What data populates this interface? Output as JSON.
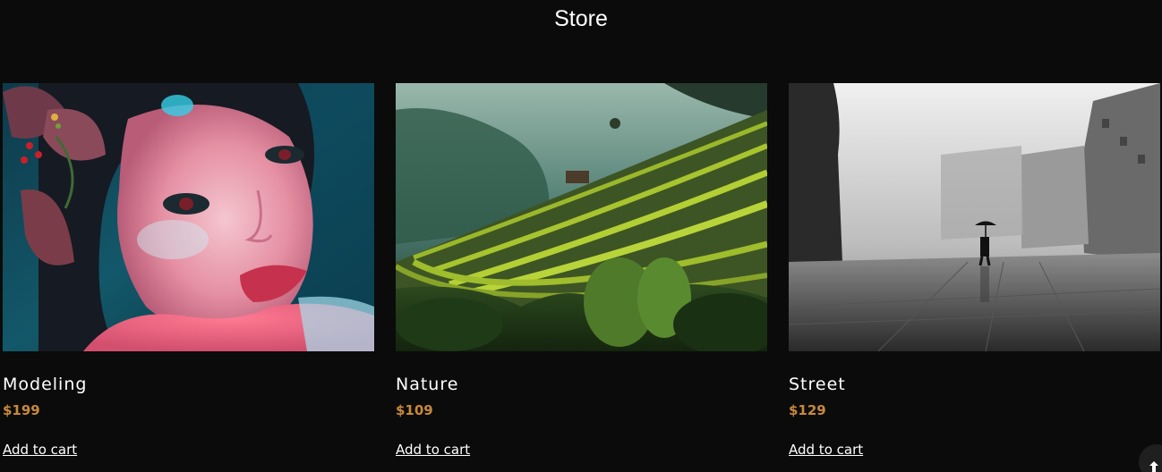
{
  "header": {
    "title": "Store"
  },
  "colors": {
    "background": "#0b0b0b",
    "price": "#c8893a",
    "text": "#ffffff"
  },
  "products": [
    {
      "name": "Modeling",
      "price": "$199",
      "cart_label": "Add to cart",
      "image": "portrait-photo"
    },
    {
      "name": "Nature",
      "price": "$109",
      "cart_label": "Add to cart",
      "image": "rice-terraces-photo"
    },
    {
      "name": "Street",
      "price": "$129",
      "cart_label": "Add to cart",
      "image": "foggy-street-photo"
    }
  ],
  "scroll_top": {
    "icon": "arrow-up-icon"
  }
}
